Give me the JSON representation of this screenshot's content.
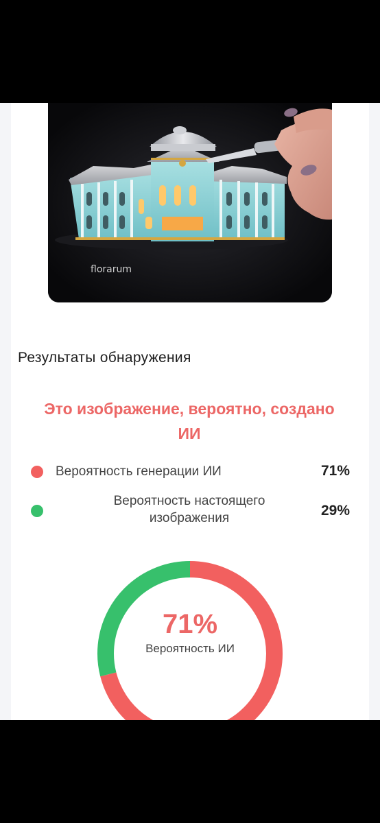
{
  "image": {
    "watermark": "florarum"
  },
  "results": {
    "title": "Результаты обнаружения",
    "verdict": "Это изображение, вероятно, создано ИИ",
    "ai": {
      "label": "Вероятность генерации ИИ",
      "value_text": "71%",
      "value": 71,
      "color": "#f2605f"
    },
    "real": {
      "label": "Вероятность настоящего изображения",
      "value_text": "29%",
      "value": 29,
      "color": "#37c06c"
    }
  },
  "donut": {
    "center_value": "71%",
    "center_label": "Вероятность ИИ"
  },
  "colors": {
    "accent_red": "#ec6766",
    "accent_green": "#37c06c",
    "background": "#f4f5f8"
  }
}
